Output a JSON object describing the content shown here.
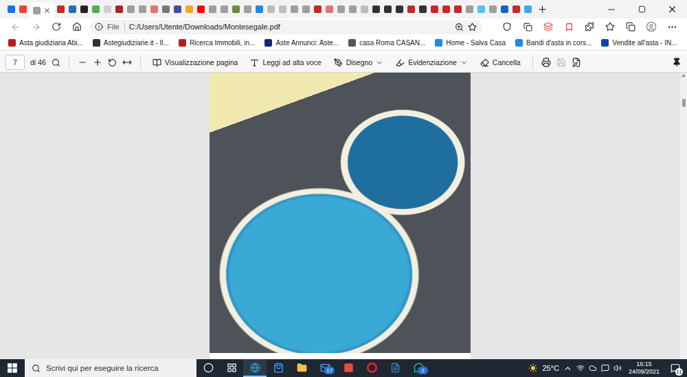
{
  "tabs": [
    {
      "selected": false,
      "color": "#1a73e8"
    },
    {
      "selected": false,
      "color": "#ea4335"
    },
    {
      "selected": true,
      "color": "#9e9e9e"
    },
    {
      "selected": false,
      "color": "#c62828"
    },
    {
      "selected": false,
      "color": "#2b6cb0"
    },
    {
      "selected": false,
      "color": "#222222"
    },
    {
      "selected": false,
      "color": "#4caf50"
    },
    {
      "selected": false,
      "color": "#cfcfcf"
    },
    {
      "selected": false,
      "color": "#b22222"
    },
    {
      "selected": false,
      "color": "#9e9e9e"
    },
    {
      "selected": false,
      "color": "#9e9e9e"
    },
    {
      "selected": false,
      "color": "#e57373"
    },
    {
      "selected": false,
      "color": "#777777"
    },
    {
      "selected": false,
      "color": "#44508a"
    },
    {
      "selected": false,
      "color": "#f5a623"
    },
    {
      "selected": false,
      "color": "#ff0000"
    },
    {
      "selected": false,
      "color": "#9e9e9e"
    },
    {
      "selected": false,
      "color": "#9e9e9e"
    },
    {
      "selected": false,
      "color": "#6d8b3a"
    },
    {
      "selected": false,
      "color": "#9e9e9e"
    },
    {
      "selected": false,
      "color": "#1e88e5"
    },
    {
      "selected": false,
      "color": "#bdbdbd"
    },
    {
      "selected": false,
      "color": "#bdbdbd"
    },
    {
      "selected": false,
      "color": "#9e9e9e"
    },
    {
      "selected": false,
      "color": "#9e9e9e"
    },
    {
      "selected": false,
      "color": "#c62828"
    },
    {
      "selected": false,
      "color": "#e57373"
    },
    {
      "selected": false,
      "color": "#9e9e9e"
    },
    {
      "selected": false,
      "color": "#9e9e9e"
    },
    {
      "selected": false,
      "color": "#bdbdbd"
    },
    {
      "selected": false,
      "color": "#333333"
    },
    {
      "selected": false,
      "color": "#333333"
    },
    {
      "selected": false,
      "color": "#333333"
    },
    {
      "selected": false,
      "color": "#c62828"
    },
    {
      "selected": false,
      "color": "#333333"
    },
    {
      "selected": false,
      "color": "#c62828"
    },
    {
      "selected": false,
      "color": "#c62828"
    },
    {
      "selected": false,
      "color": "#c62828"
    },
    {
      "selected": false,
      "color": "#9e9e9e"
    },
    {
      "selected": false,
      "color": "#4fc3f7"
    },
    {
      "selected": false,
      "color": "#9e9e9e"
    },
    {
      "selected": false,
      "color": "#1565c0"
    },
    {
      "selected": false,
      "color": "#c62828"
    },
    {
      "selected": false,
      "color": "#42a5f5"
    }
  ],
  "address_bar": {
    "scheme": "File",
    "url": "C:/Users/Utente/Downloads/Montesegale.pdf"
  },
  "favorites": [
    {
      "label": "Asta giudiziaria Abi...",
      "color": "#b71c1c"
    },
    {
      "label": "Astegiudiziarie.it - Il...",
      "color": "#333333"
    },
    {
      "label": "Ricerca Immobili, in...",
      "color": "#b71c1c"
    },
    {
      "label": "Aste Annunci: Aste...",
      "color": "#1a237e"
    },
    {
      "label": "casa Roma CASAN...",
      "color": "#555555"
    },
    {
      "label": "Home - Salva Casa",
      "color": "#1e88e5"
    },
    {
      "label": "Bandi d'asta in cors...",
      "color": "#1e88e5"
    },
    {
      "label": "Vendite all'asta - IN...",
      "color": "#0d47a1"
    }
  ],
  "pdf_toolbar": {
    "page": "7",
    "total": "di 46",
    "buttons": [
      {
        "label": "Visualizzazione pagina",
        "kind": "view",
        "dropdown": false
      },
      {
        "label": "Leggi ad alta voce",
        "kind": "read",
        "dropdown": false
      },
      {
        "label": "Disegno",
        "kind": "draw",
        "dropdown": true
      },
      {
        "label": "Evidenziazione",
        "kind": "highlight",
        "dropdown": true
      },
      {
        "label": "Cancella",
        "kind": "erase",
        "dropdown": false
      }
    ]
  },
  "scrollbar": {
    "position": 0.08
  },
  "taskbar": {
    "search_placeholder": "Scrivi qui per eseguire la ricerca",
    "apps": [
      {
        "kind": "cortana",
        "active": false,
        "badge": "",
        "color": "#ffffff"
      },
      {
        "kind": "taskview",
        "active": false,
        "badge": "",
        "color": "#ffffff"
      },
      {
        "kind": "edge",
        "active": true,
        "badge": "",
        "color": "#2fa3d8"
      },
      {
        "kind": "store",
        "active": false,
        "badge": "",
        "color": "#4aa3ff"
      },
      {
        "kind": "explorer",
        "active": false,
        "badge": "",
        "color": "#f5c542"
      },
      {
        "kind": "mail",
        "active": false,
        "badge": "17",
        "color": "#4aa3ff"
      },
      {
        "kind": "office",
        "active": false,
        "badge": "",
        "color": "#e74c3c"
      },
      {
        "kind": "opera",
        "active": false,
        "badge": "",
        "color": "#ff1b2d"
      },
      {
        "kind": "writer",
        "active": false,
        "badge": "",
        "color": "#3b8fd9"
      },
      {
        "kind": "whatsapp",
        "active": false,
        "badge": "2",
        "color": "#25d366"
      }
    ],
    "weather": "25°C",
    "time": "16:15",
    "date": "24/09/2021",
    "notifications": "11"
  }
}
